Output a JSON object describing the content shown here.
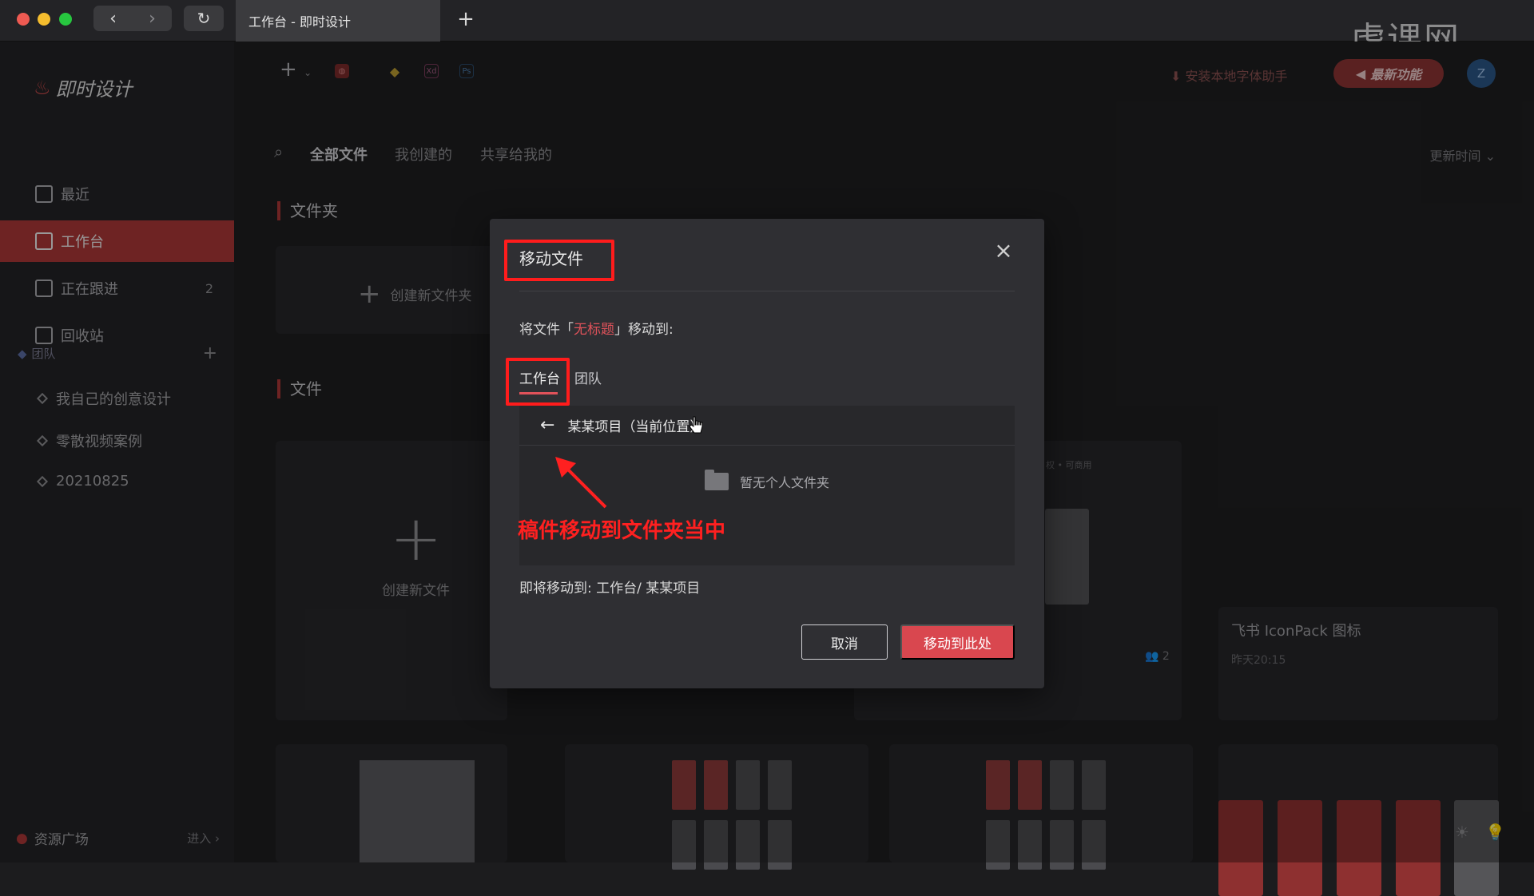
{
  "browser": {
    "back_icon": "‹",
    "forward_icon": "›",
    "reload_icon": "↻",
    "tab_title": "工作台 - 即时设计",
    "new_tab_icon": "+"
  },
  "watermark": {
    "text": "虎课网"
  },
  "sidebar": {
    "logo": "即时设计",
    "items": [
      {
        "label": "最近",
        "count": ""
      },
      {
        "label": "工作台",
        "count": ""
      },
      {
        "label": "正在跟进",
        "count": "2"
      },
      {
        "label": "回收站",
        "count": ""
      }
    ],
    "team_header": "团队",
    "team_add": "+",
    "teams": [
      {
        "label": "我自己的创意设计"
      },
      {
        "label": "零散视频案例"
      },
      {
        "label": "20210825"
      }
    ],
    "resource": {
      "label": "资源广场",
      "enter": "进入 ›"
    }
  },
  "toolbar": {
    "install_font": "安装本地字体助手",
    "new_features": "最新功能",
    "avatar_initial": "Z",
    "chips": [
      "Xd",
      "Ps"
    ]
  },
  "filters": {
    "tabs": [
      "全部文件",
      "我创建的",
      "共享给我的"
    ],
    "sort": "更新时间 ⌄"
  },
  "sections": {
    "folders": "文件夹",
    "create_folder": "创建新文件夹",
    "files": "文件",
    "create_file": "创建新文件"
  },
  "files": [
    {
      "name": "飞书 IconPack 图标",
      "time": "昨天20:15"
    }
  ],
  "file_members": "2",
  "file_note": "权 • 可商用",
  "modal": {
    "title": "移动文件",
    "close_icon": "×",
    "desc_prefix": "将文件「",
    "desc_name": "无标题",
    "desc_suffix": "」移动到:",
    "tabs": [
      "工作台",
      "团队"
    ],
    "current_folder": "某某项目（当前位置）",
    "back_arrow": "←",
    "empty_text": "暂无个人文件夹",
    "annotation": "稿件移动到文件夹当中",
    "target_label": "即将移动到:",
    "target_path": "工作台/ 某某项目",
    "cancel": "取消",
    "confirm": "移动到此处"
  },
  "colors": {
    "accent": "#d9474f",
    "highlight": "#ff1c1c",
    "sidebar_active": "#a93737"
  }
}
